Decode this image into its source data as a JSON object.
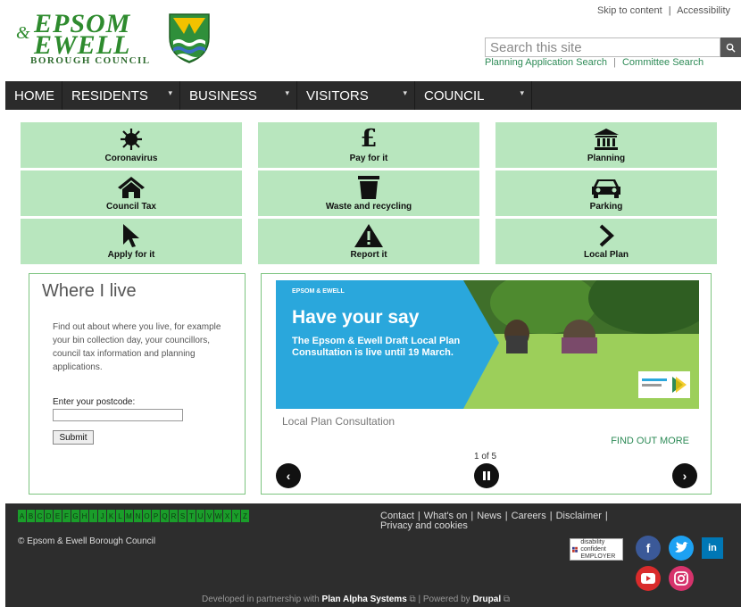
{
  "header": {
    "logo_line1": "EPSOM",
    "logo_amp": "&",
    "logo_line2": "EWELL",
    "logo_sub": "BOROUGH COUNCIL",
    "skip_link": "Skip to content",
    "accessibility_link": "Accessibility",
    "search_placeholder": "Search this site",
    "planning_search": "Planning Application Search",
    "committee_search": "Committee Search"
  },
  "nav": {
    "items": [
      {
        "label": "HOME",
        "has_dropdown": false
      },
      {
        "label": "RESIDENTS",
        "has_dropdown": true
      },
      {
        "label": "BUSINESS",
        "has_dropdown": true
      },
      {
        "label": "VISITORS",
        "has_dropdown": true
      },
      {
        "label": "COUNCIL",
        "has_dropdown": true
      }
    ]
  },
  "tiles": [
    {
      "label": "Coronavirus",
      "icon": "virus-icon"
    },
    {
      "label": "Pay for it",
      "icon": "pound-icon"
    },
    {
      "label": "Planning",
      "icon": "building-columns-icon"
    },
    {
      "label": "Council Tax",
      "icon": "house-icon"
    },
    {
      "label": "Waste and recycling",
      "icon": "bin-icon"
    },
    {
      "label": "Parking",
      "icon": "car-icon"
    },
    {
      "label": "Apply for it",
      "icon": "cursor-icon"
    },
    {
      "label": "Report it",
      "icon": "warning-icon"
    },
    {
      "label": "Local Plan",
      "icon": "chevron-right-icon"
    }
  ],
  "where": {
    "title": "Where I live",
    "description": "Find out about where you live, for example your bin collection day, your councillors, council tax information and planning applications.",
    "postcode_label": "Enter your postcode:",
    "postcode_value": "",
    "submit_label": "Submit"
  },
  "slideshow": {
    "banner_mini": "EPSOM & EWELL",
    "banner_title": "Have your say",
    "banner_body": "The Epsom & Ewell Draft Local Plan Consultation is live until 19 March.",
    "caption": "Local Plan Consultation",
    "find_more": "FIND OUT MORE",
    "counter": "1 of 5"
  },
  "footer": {
    "az": [
      "A",
      "B",
      "C",
      "D",
      "E",
      "F",
      "G",
      "H",
      "I",
      "J",
      "K",
      "L",
      "M",
      "N",
      "O",
      "P",
      "Q",
      "R",
      "S",
      "T",
      "U",
      "V",
      "W",
      "X",
      "Y",
      "Z"
    ],
    "links": [
      "Contact",
      "What's on",
      "News",
      "Careers",
      "Disclaimer",
      "Privacy and cookies"
    ],
    "copyright": "© Epsom & Ewell Borough Council",
    "badge": "disability confident EMPLOYER",
    "credits_prefix": "Developed in partnership with",
    "credits_partner": "Plan Alpha Systems",
    "credits_mid": "| Powered by",
    "credits_cms": "Drupal"
  },
  "colors": {
    "tile": "#b8e6be",
    "nav": "#2b2b2b",
    "accent": "#2e8b57",
    "footer": "#2d2d2d"
  }
}
